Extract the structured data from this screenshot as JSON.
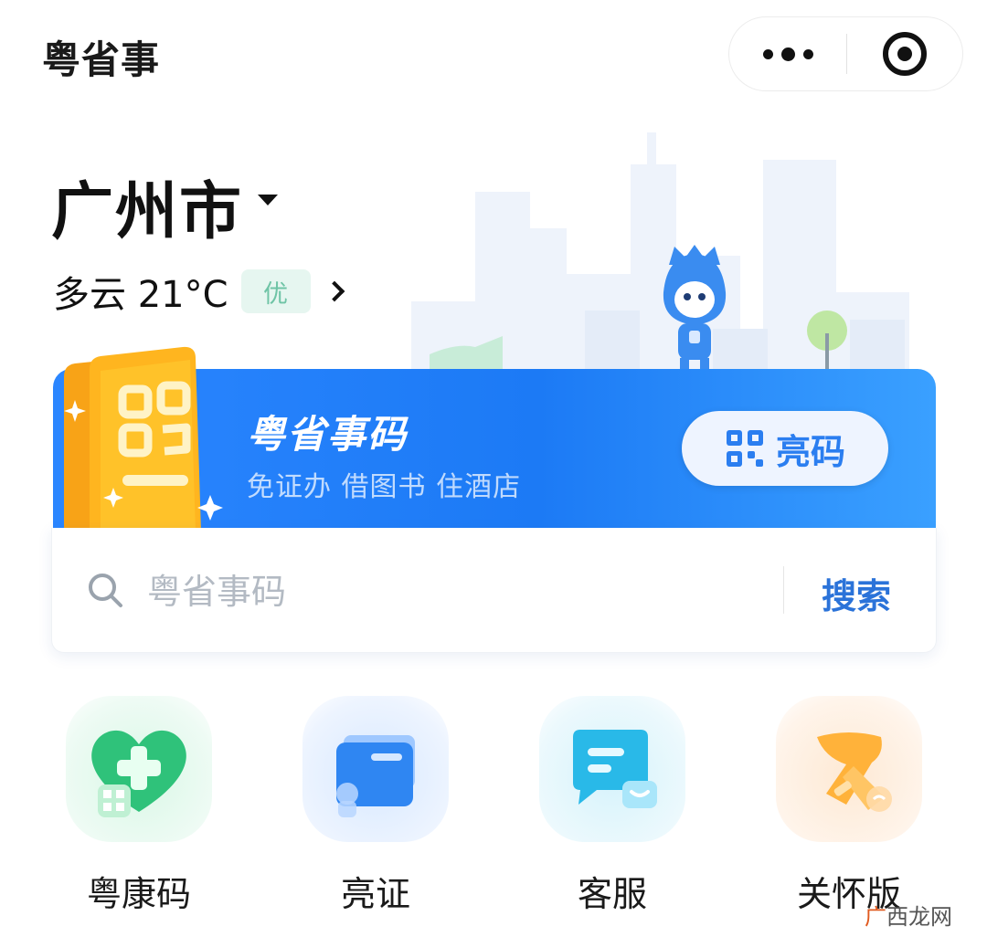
{
  "header": {
    "title": "粤省事"
  },
  "location": {
    "city": "广州市",
    "weather": "多云 21°C",
    "aqi": "优"
  },
  "banner": {
    "title": "粤省事码",
    "subtitle": "免证办 借图书 住酒店",
    "show_code_label": "亮码"
  },
  "search": {
    "placeholder": "粤省事码",
    "button_label": "搜索"
  },
  "shortcuts": [
    {
      "label": "粤康码",
      "icon": "health-heart-icon"
    },
    {
      "label": "亮证",
      "icon": "wallet-card-icon"
    },
    {
      "label": "客服",
      "icon": "chat-bubble-icon"
    },
    {
      "label": "关怀版",
      "icon": "scarf-icon"
    }
  ],
  "watermark": {
    "part1": "广",
    "part2": "西龙网"
  },
  "colors": {
    "accent": "#2b86ff",
    "search_button": "#2b73d9",
    "aqi_text": "#6fc4a6"
  }
}
